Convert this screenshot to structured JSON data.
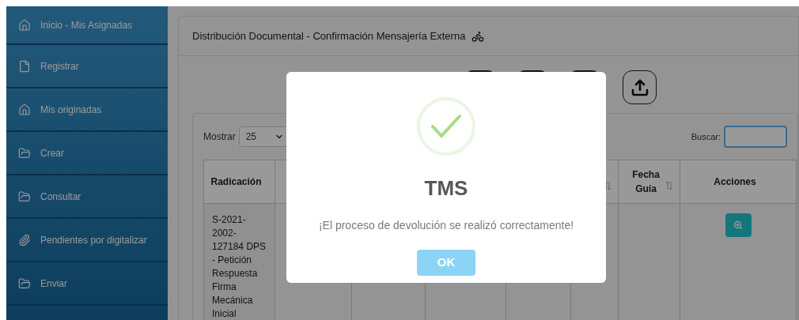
{
  "sidebar": {
    "items": [
      {
        "label": "Inicio - Mis Asignadas",
        "kind": "home"
      },
      {
        "label": "Registrar",
        "kind": "file"
      },
      {
        "label": "Mis originadas",
        "kind": "home"
      },
      {
        "label": "Crear",
        "kind": "folder"
      },
      {
        "label": "Consultar",
        "kind": "folder"
      },
      {
        "label": "Pendientes por digitalizar",
        "kind": "attachment"
      },
      {
        "label": "Enviar",
        "kind": "folder"
      }
    ]
  },
  "panel": {
    "title": "Distribución Documental - Confirmación Mensajería Externa"
  },
  "table": {
    "length_label": "Mostrar",
    "length_value": "25",
    "search_label": "Buscar:",
    "columns": [
      {
        "label": "Radicación",
        "sortable": false
      },
      {},
      {},
      {},
      {},
      {
        "sortable": true
      },
      {
        "label": "Fecha Guía",
        "sortable": true
      },
      {
        "label": "Acciones",
        "sortable": false
      }
    ],
    "rows": [
      {
        "cells": [
          "S-2021-2002-127184 DPS - Petición Respuesta Firma Mecánica Inicial"
        ]
      }
    ]
  },
  "modal": {
    "kind": "success",
    "title": "TMS",
    "message": "¡El proceso de devolución se realizó correctamente!",
    "button": "OK"
  }
}
